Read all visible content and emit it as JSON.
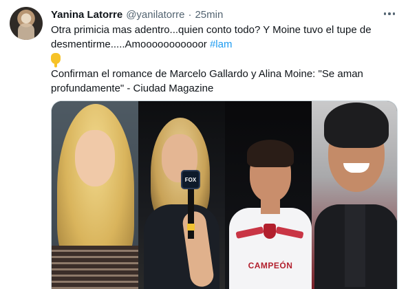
{
  "author": {
    "name": "Yanina Latorre",
    "handle": "@yanilatorre",
    "separator": "·",
    "time": "25min"
  },
  "tweet": {
    "line1": "Otra primicia mas adentro...quien conto todo? Y Moine tuvo el tupe de",
    "line2_text": "desmentirme.....Amooooooooooor ",
    "hashtag": "#lam",
    "emoji": "pointing-down-emoji",
    "link_line1": "Confirman el romance de Marcelo Gallardo y Alina Moine: \"Se aman",
    "link_line2": "profundamente\" - Ciudad Magazine"
  },
  "media": {
    "mic_label": "FOX",
    "jersey_text": "CAMPEÓN"
  },
  "colors": {
    "hashtag": "#1d9bf0",
    "secondary_text": "#536471",
    "primary_text": "#0f1419"
  },
  "icons": {
    "more": "more-horizontal-icon"
  }
}
